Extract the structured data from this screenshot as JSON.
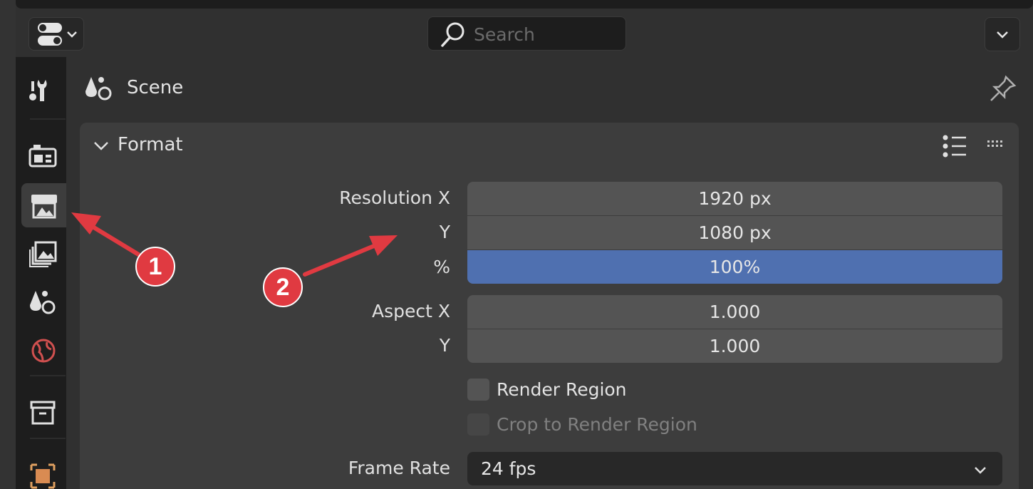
{
  "header": {
    "search_placeholder": "Search"
  },
  "breadcrumb": {
    "title": "Scene"
  },
  "format_panel": {
    "title": "Format",
    "resolution_x_label": "Resolution X",
    "resolution_x_value": "1920 px",
    "resolution_y_label": "Y",
    "resolution_y_value": "1080 px",
    "percent_label": "%",
    "percent_value": "100%",
    "aspect_x_label": "Aspect X",
    "aspect_x_value": "1.000",
    "aspect_y_label": "Y",
    "aspect_y_value": "1.000",
    "render_region_label": "Render Region",
    "crop_region_label": "Crop to Render Region",
    "frame_rate_label": "Frame Rate",
    "frame_rate_value": "24 fps"
  },
  "annotations": {
    "badge_1": "1",
    "badge_2": "2"
  },
  "colors": {
    "accent_blue": "#4f70b0",
    "annotation_red": "#e03a41"
  },
  "icons": [
    "editor-type-icon",
    "search-icon",
    "chevron-down-icon",
    "tool-icon",
    "render-icon",
    "output-icon",
    "view-layer-icon",
    "scene-icon",
    "world-icon",
    "collection-icon",
    "object-icon",
    "pin-icon",
    "list-icon",
    "drag-handle-icon"
  ]
}
